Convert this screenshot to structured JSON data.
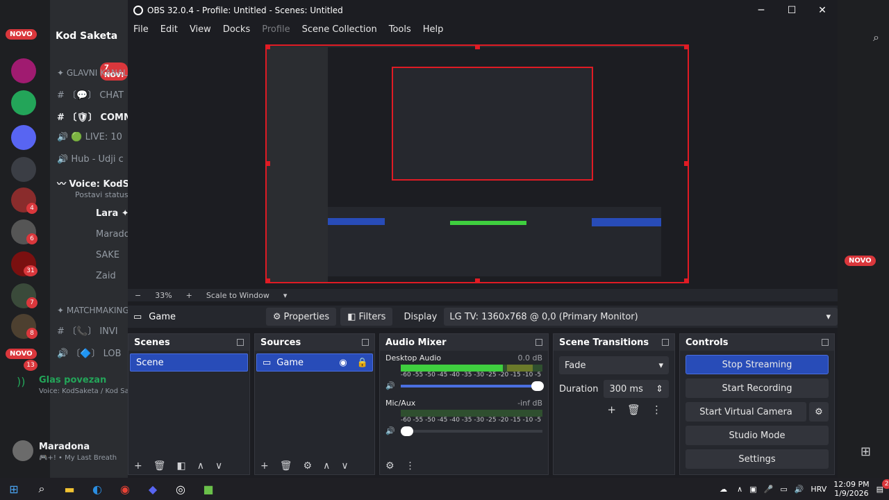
{
  "discord": {
    "badges": {
      "novo": "NOVO",
      "new7": "7 NOVI",
      "count4": "4",
      "count6": "6",
      "count31": "31",
      "count7": "7",
      "count8": "8",
      "count13": "13"
    },
    "server_name": "Kod Saketa",
    "channels": [
      "✦ GLAVNI KANALI",
      "# 〔💬〕 CHAT",
      "# 〔🛡〕 COMM",
      "🔊 🟢 LIVE: 10",
      "🔊 Hub - Udji c",
      "〰 Voice: KodS"
    ],
    "status_sub": "Postavi status K",
    "voice_users": [
      "Lara ✦",
      "Marado",
      "SAKE",
      "Zaid"
    ],
    "section2": "✦ MATCHMAKING",
    "ch2": [
      "# 〔📞〕 INVI",
      "🔊 〔🔷〕 LOB"
    ],
    "voice_status": "Glas povezan",
    "voice_sub": "Voice: KodSaketa / Kod Sa",
    "user": {
      "name": "Maradona",
      "status": "🎮+! • My Last Breath"
    },
    "right_badge": "NOVO"
  },
  "obs": {
    "title": "OBS 32.0.4 - Profile: Untitled - Scenes: Untitled",
    "menu": [
      "File",
      "Edit",
      "View",
      "Docks",
      "Profile",
      "Scene Collection",
      "Tools",
      "Help"
    ],
    "zoom": {
      "minus": "−",
      "percent": "33%",
      "plus": "+",
      "scale": "Scale to Window",
      "arrow": "▾"
    },
    "source_bar": {
      "name": "Game",
      "properties": "Properties",
      "filters": "Filters",
      "display_label": "Display",
      "display_value": "LG TV: 1360x768 @ 0,0 (Primary Monitor)"
    },
    "scenes": {
      "title": "Scenes",
      "items": [
        "Scene"
      ]
    },
    "sources": {
      "title": "Sources",
      "items": [
        "Game"
      ]
    },
    "audio": {
      "title": "Audio Mixer",
      "channels": [
        {
          "name": "Desktop Audio",
          "db": "0.0 dB",
          "level": 0.72
        },
        {
          "name": "Mic/Aux",
          "db": "-inf dB",
          "level": 0
        }
      ],
      "ticks": "-60 -55 -50 -45 -40 -35 -30 -25 -20 -15 -10 -5 0"
    },
    "transitions": {
      "title": "Scene Transitions",
      "type": "Fade",
      "duration_label": "Duration",
      "duration_value": "300 ms"
    },
    "controls": {
      "title": "Controls",
      "buttons": [
        "Stop Streaming",
        "Start Recording",
        "Start Virtual Camera",
        "Studio Mode",
        "Settings"
      ]
    }
  },
  "taskbar": {
    "time": "12:09 PM",
    "date": "1/9/2026",
    "lang": "HRV",
    "notif": "2"
  }
}
